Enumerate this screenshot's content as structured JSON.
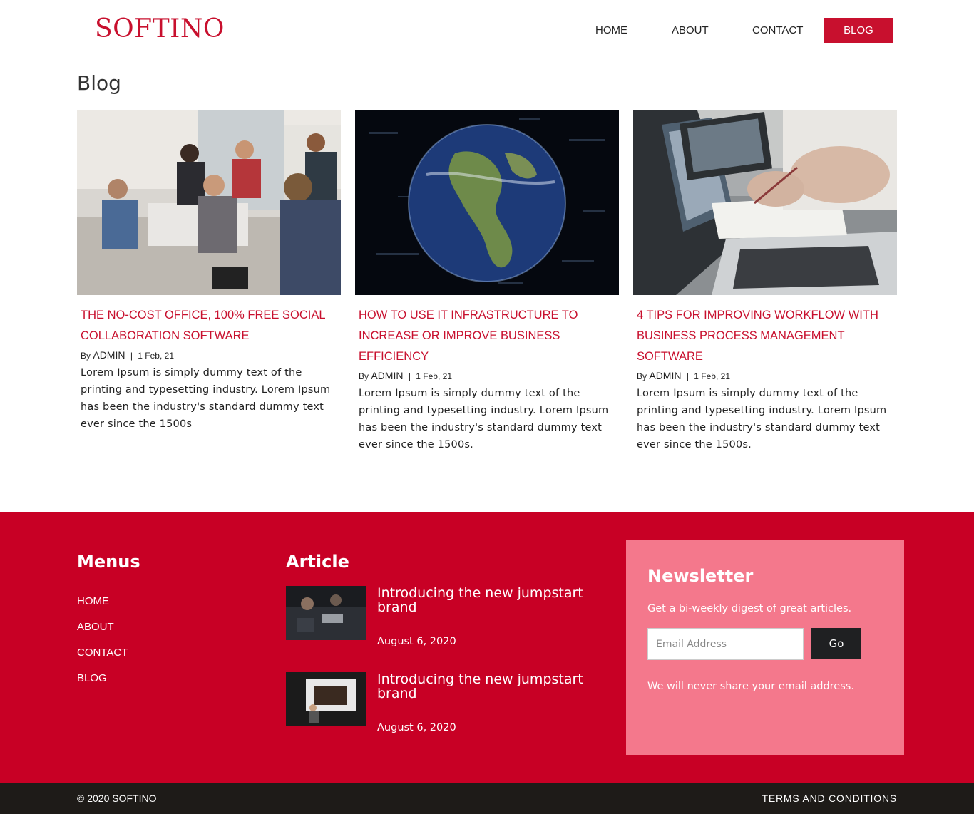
{
  "header": {
    "logo": "SOFTINO",
    "nav": {
      "home": "HOME",
      "about": "ABOUT",
      "contact": "CONTACT",
      "blog": "BLOG"
    }
  },
  "page_title": "Blog",
  "posts": [
    {
      "title": "THE NO-COST OFFICE, 100% FREE SOCIAL COLLABORATION SOFTWARE",
      "by": "By",
      "author": "ADMIN",
      "sep": "|",
      "date": "1 Feb, 21",
      "excerpt": "Lorem Ipsum is simply dummy text of the printing and typesetting industry. Lorem Ipsum has been the industry's standard dummy text ever since the 1500s"
    },
    {
      "title": "HOW TO USE IT INFRASTRUCTURE TO INCREASE OR IMPROVE BUSINESS EFFICIENCY",
      "by": "By",
      "author": "ADMIN",
      "sep": "|",
      "date": "1 Feb, 21",
      "excerpt": "Lorem Ipsum is simply dummy text of the printing and typesetting industry. Lorem Ipsum has been the industry's standard dummy text ever since the 1500s."
    },
    {
      "title": "4 TIPS FOR IMPROVING WORKFLOW WITH BUSINESS PROCESS MANAGEMENT SOFTWARE",
      "by": "By",
      "author": "ADMIN",
      "sep": "|",
      "date": "1 Feb, 21",
      "excerpt": "Lorem Ipsum is simply dummy text of the printing and typesetting industry. Lorem Ipsum has been the industry's standard dummy text ever since the 1500s."
    }
  ],
  "footer": {
    "menus_heading": "Menus",
    "menus": [
      "HOME",
      "ABOUT",
      "CONTACT",
      "BLOG"
    ],
    "article_heading": "Article",
    "articles": [
      {
        "title": "Introducing the new jumpstart brand",
        "date": "August 6, 2020"
      },
      {
        "title": "Introducing the new jumpstart brand",
        "date": "August 6, 2020"
      }
    ],
    "newsletter": {
      "title": "Newsletter",
      "subtitle": "Get a bi-weekly digest of great articles.",
      "email_placeholder": "Email Address",
      "button": "Go",
      "note": "We will never share your email address."
    }
  },
  "bottom": {
    "copyright": "© 2020 SOFTINO",
    "terms": "TERMS AND CONDITIONS"
  },
  "colors": {
    "brand_red": "#c8102e",
    "footer_red": "#c80025",
    "newsletter_pink": "#f4788c",
    "dark": "#1e1b18"
  }
}
